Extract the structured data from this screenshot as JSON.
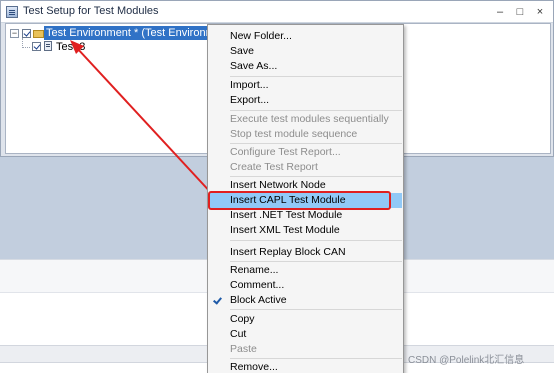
{
  "window": {
    "title": "Test Setup for Test Modules",
    "minimize_glyph": "–",
    "maximize_glyph": "□",
    "close_glyph": "×"
  },
  "tree": {
    "environment_label": "Test Environment *  (Test Environment.tse)",
    "child_label": "Test 3"
  },
  "menu": {
    "items": [
      {
        "label": "New Folder...",
        "enabled": true
      },
      {
        "label": "Save",
        "enabled": true
      },
      {
        "label": "Save As...",
        "enabled": true
      },
      {
        "label": "Import...",
        "enabled": true
      },
      {
        "label": "Export...",
        "enabled": true
      },
      {
        "label": "Execute test modules sequentially",
        "enabled": false
      },
      {
        "label": "Stop test module sequence",
        "enabled": false
      },
      {
        "label": "Configure Test Report...",
        "enabled": false
      },
      {
        "label": "Create Test Report",
        "enabled": false
      },
      {
        "label": "Insert Network Node",
        "enabled": true
      },
      {
        "label": "Insert CAPL Test Module",
        "enabled": true,
        "highlighted": true
      },
      {
        "label": "Insert .NET Test Module",
        "enabled": true
      },
      {
        "label": "Insert XML Test Module",
        "enabled": true
      },
      {
        "label": "Insert Replay Block CAN",
        "enabled": true
      },
      {
        "label": "Rename...",
        "enabled": true
      },
      {
        "label": "Comment...",
        "enabled": true
      },
      {
        "label": "Block Active",
        "enabled": true,
        "checked": true
      },
      {
        "label": "Copy",
        "enabled": true
      },
      {
        "label": "Cut",
        "enabled": true
      },
      {
        "label": "Paste",
        "enabled": false
      },
      {
        "label": "Remove...",
        "enabled": true
      }
    ]
  },
  "watermark": "CSDN @Polelink北汇信息",
  "colors": {
    "selection": "#3072c6",
    "menu_highlight": "#91c9f7",
    "annotation": "#e02020"
  }
}
